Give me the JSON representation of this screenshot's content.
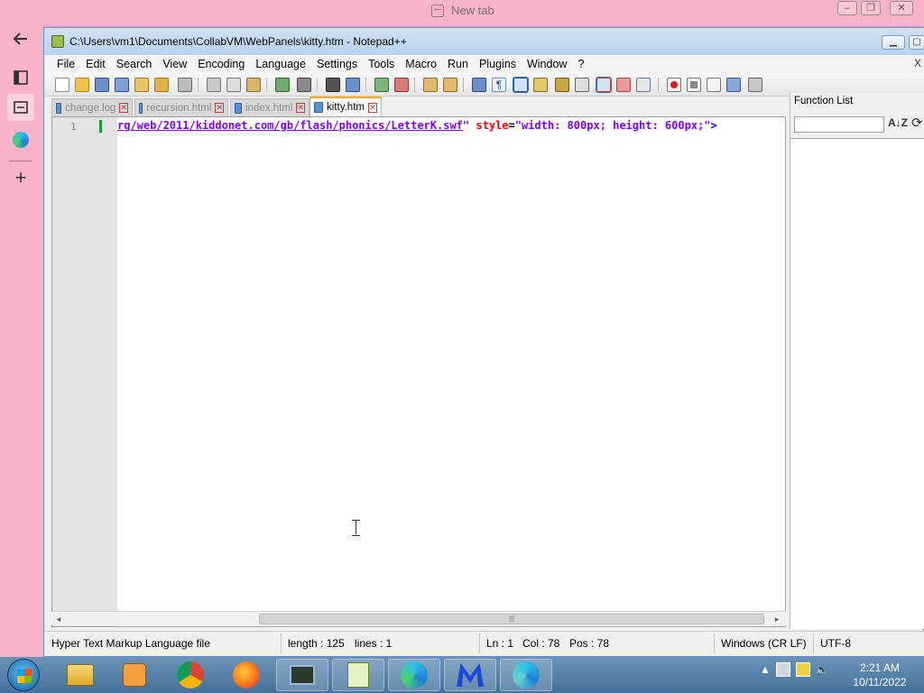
{
  "browser": {
    "tab_title": "New tab",
    "window_buttons": [
      "–",
      "❐",
      "✕"
    ],
    "sidebar_icons": [
      "back-arrow-icon",
      "tabs-icon",
      "collections-icon",
      "edge-icon",
      "add-icon"
    ]
  },
  "npp": {
    "title": "C:\\Users\\vm1\\Documents\\CollabVM\\WebPanels\\kitty.htm - Notepad++",
    "menu": [
      "File",
      "Edit",
      "Search",
      "View",
      "Encoding",
      "Language",
      "Settings",
      "Tools",
      "Macro",
      "Run",
      "Plugins",
      "Window",
      "?"
    ],
    "menu_close": "X",
    "tabs": [
      {
        "label": "change.log",
        "active": false
      },
      {
        "label": "recursion.html",
        "active": false
      },
      {
        "label": "index.html",
        "active": false
      },
      {
        "label": "kitty.htm",
        "active": true
      }
    ],
    "editor": {
      "line_number": "1",
      "code": {
        "url": "rg/web/2011/kiddonet.com/gb/flash/phonics/LetterK.swf",
        "quote_close": "\"",
        "attr": " style",
        "eq": "=",
        "value": "\"width: 800px; height: 600px;\"",
        "close": ">"
      }
    },
    "function_list": {
      "title": "Function List",
      "search_placeholder": "",
      "sort_label": "A↓Z",
      "reload_label": "⟳"
    },
    "status": {
      "file_type": "Hyper Text Markup Language file",
      "length": "length : 125",
      "lines": "lines : 1",
      "ln": "Ln : 1",
      "col": "Col : 78",
      "pos": "Pos : 78",
      "eol": "Windows (CR LF)",
      "encoding": "UTF-8"
    }
  },
  "taskbar": {
    "apps": [
      "explorer-icon",
      "media-player-icon",
      "chrome-icon",
      "firefox-icon",
      "task-manager-icon",
      "notepadpp-icon",
      "edge-icon",
      "malwarebytes-icon",
      "edge-beta-icon"
    ],
    "time": "2:21 AM",
    "date": "10/11/2022"
  }
}
